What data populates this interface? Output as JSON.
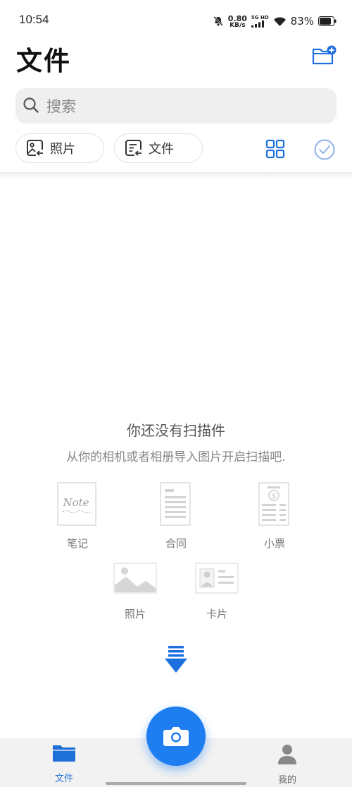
{
  "status": {
    "time": "10:54",
    "net_speed_value": "0.80",
    "net_speed_unit": "KB/s",
    "network_badge": "5G HD",
    "battery": "83%"
  },
  "header": {
    "title": "文件"
  },
  "search": {
    "placeholder": "搜索",
    "value": ""
  },
  "filters": {
    "photo_label": "照片",
    "file_label": "文件"
  },
  "empty_state": {
    "title": "你还没有扫描件",
    "subtitle": "从你的相机或者相册导入图片开启扫描吧.",
    "doc_types": [
      {
        "label": "笔记",
        "icon": "note-icon",
        "icon_text": "Note"
      },
      {
        "label": "合同",
        "icon": "contract-icon"
      },
      {
        "label": "小票",
        "icon": "receipt-icon"
      },
      {
        "label": "照片",
        "icon": "photo-icon"
      },
      {
        "label": "卡片",
        "icon": "id-card-icon"
      }
    ]
  },
  "bottom_nav": {
    "files_label": "文件",
    "mine_label": "我的"
  },
  "colors": {
    "accent": "#1e7ef0",
    "nav_active": "#1f6fd8",
    "icon_grey": "#d6d6d6"
  }
}
